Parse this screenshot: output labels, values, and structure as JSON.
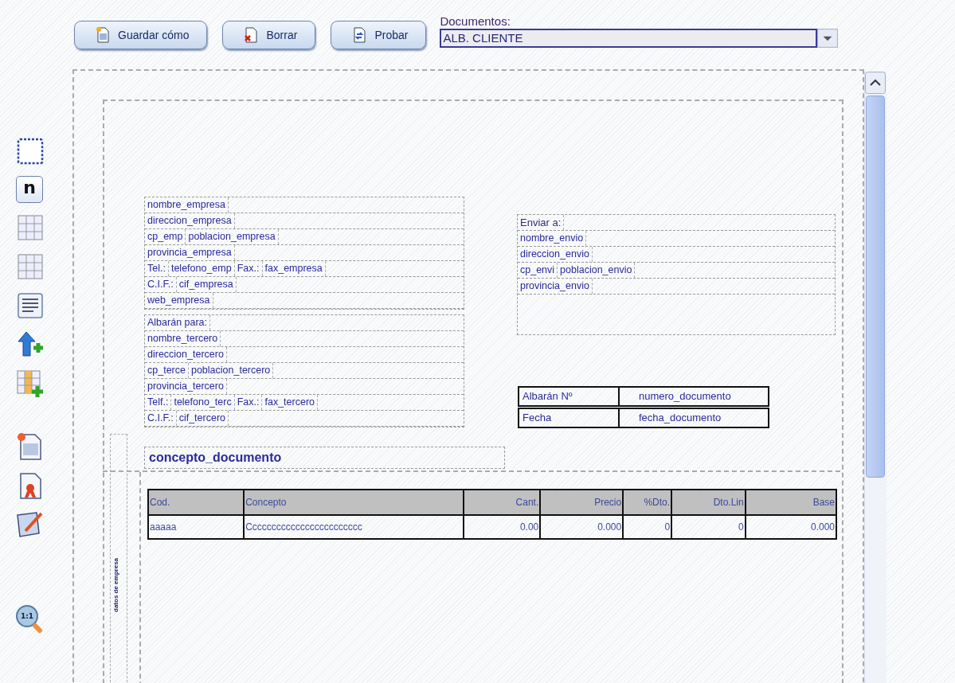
{
  "toolbar": {
    "buttons": [
      {
        "label": "Guardar cómo",
        "kind": "save"
      },
      {
        "label": "Borrar",
        "kind": "delete"
      },
      {
        "label": "Probar",
        "kind": "test"
      }
    ],
    "documents": {
      "label": "Documentos:",
      "value": "ALB. CLIENTE"
    }
  },
  "tools": [
    {
      "kind": "frame"
    },
    {
      "kind": "field",
      "glyph": "n"
    },
    {
      "kind": "grid"
    },
    {
      "kind": "grid"
    },
    {
      "kind": "text"
    },
    {
      "kind": "arrow-add"
    },
    {
      "kind": "column-add"
    },
    {
      "kind": "new-page"
    },
    {
      "kind": "certificate"
    },
    {
      "kind": "edit"
    },
    {
      "kind": "zoom",
      "glyph": "1:1"
    }
  ],
  "canvas": {
    "empresa_block": [
      [
        "nombre_empresa"
      ],
      [
        "direccion_empresa"
      ],
      [
        "cp_emp",
        "poblacion_empresa"
      ],
      [
        "provincia_empresa"
      ],
      [
        "Tel.:",
        "telefono_emp",
        "Fax.:",
        "fax_empresa"
      ],
      [
        "C.I.F.:",
        "cif_empresa"
      ],
      [
        "web_empresa"
      ]
    ],
    "tercero_block": [
      [
        "Albarán para:"
      ],
      [
        "nombre_tercero"
      ],
      [
        "direccion_tercero"
      ],
      [
        "cp_terce",
        "poblacion_tercero"
      ],
      [
        "provincia_tercero"
      ],
      [
        "Telf.:",
        "telefono_terc",
        "Fax.:",
        "fax_tercero"
      ],
      [
        "C.I.F.:",
        "cif_tercero"
      ]
    ],
    "envio_block": [
      [
        "Enviar a:"
      ],
      [
        "nombre_envio"
      ],
      [
        "direccion_envio"
      ],
      [
        "cp_envi",
        "poblacion_envio"
      ],
      [
        "provincia_envio"
      ]
    ],
    "document_info": [
      [
        "Albarán Nº",
        "numero_documento"
      ],
      [
        "Fecha",
        "fecha_documento"
      ]
    ],
    "concepto": "concepto_documento",
    "vertical_label": "datos de empresa",
    "table": {
      "columns": [
        "Cod.",
        "Concepto",
        "Cant.",
        "Precio",
        "%Dto.",
        "Dto.Lin",
        "Base"
      ],
      "rows": [
        [
          "aaaaa",
          "Cccccccccccccccccccccccc",
          "0.00",
          "0.000",
          "0",
          "0",
          "0.000"
        ]
      ]
    }
  }
}
